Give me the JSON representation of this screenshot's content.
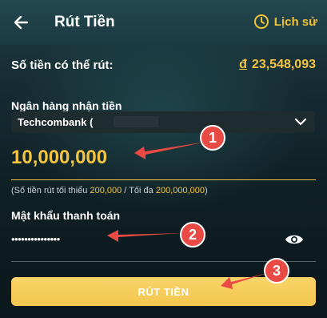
{
  "header": {
    "title": "Rút Tiền",
    "history_label": "Lịch sử"
  },
  "balance": {
    "label": "Số tiền có thể rút:",
    "currency_symbol": "đ",
    "amount": "23,548,093"
  },
  "bank": {
    "label": "Ngân hàng nhận tiền",
    "selected": "Techcombank",
    "suffix": "("
  },
  "amount": {
    "value": "10,000,000",
    "hint_prefix": "(Số tiền rút tối thiểu",
    "min": "200,000",
    "hint_mid": "/ Tối đa",
    "max": "200,000,000",
    "hint_suffix": ")"
  },
  "password": {
    "label": "Mật khẩu thanh toán",
    "value": "•••••••••••••••"
  },
  "submit": {
    "label": "RÚT TIỀN"
  },
  "callouts": [
    "1",
    "2",
    "3"
  ],
  "colors": {
    "accent": "#f5c542",
    "button": "#f3c74f",
    "callout": "#e94a43",
    "background": "#152a31"
  },
  "icons": {
    "back": "arrow-left-icon",
    "history": "clock-icon",
    "dropdown": "chevron-down-icon",
    "password": "eye-icon"
  }
}
